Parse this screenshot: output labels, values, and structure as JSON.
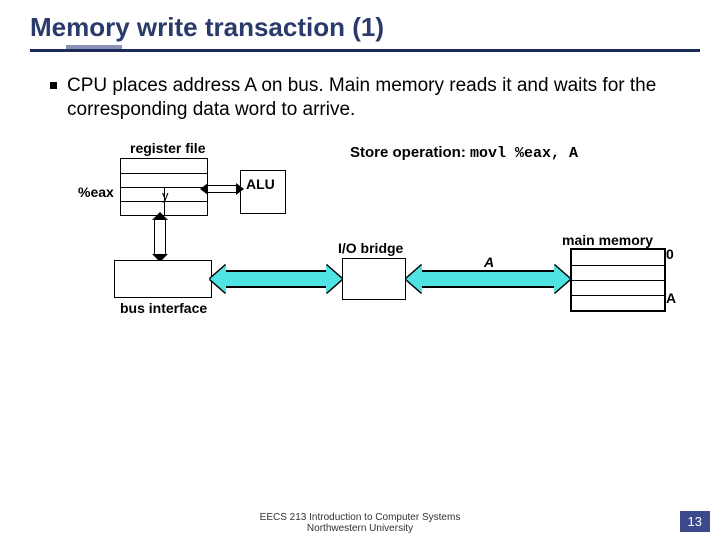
{
  "title": "Memory write transaction (1)",
  "bullet": "CPU places address A on bus. Main memory reads it and waits for the corresponding data word to arrive.",
  "store_op_label": "Store operation:",
  "store_op_code": "movl %eax, A",
  "labels": {
    "register_file": "register file",
    "eax": "%eax",
    "y": "y",
    "alu": "ALU",
    "io_bridge": "I/O bridge",
    "bus_interface": "bus interface",
    "main_memory": "main memory",
    "A_on_bus": "A",
    "mem_index_0": "0",
    "mem_addr_A": "A"
  },
  "footer_line1": "EECS 213 Introduction to Computer Systems",
  "footer_line2": "Northwestern University",
  "page_number": "13"
}
